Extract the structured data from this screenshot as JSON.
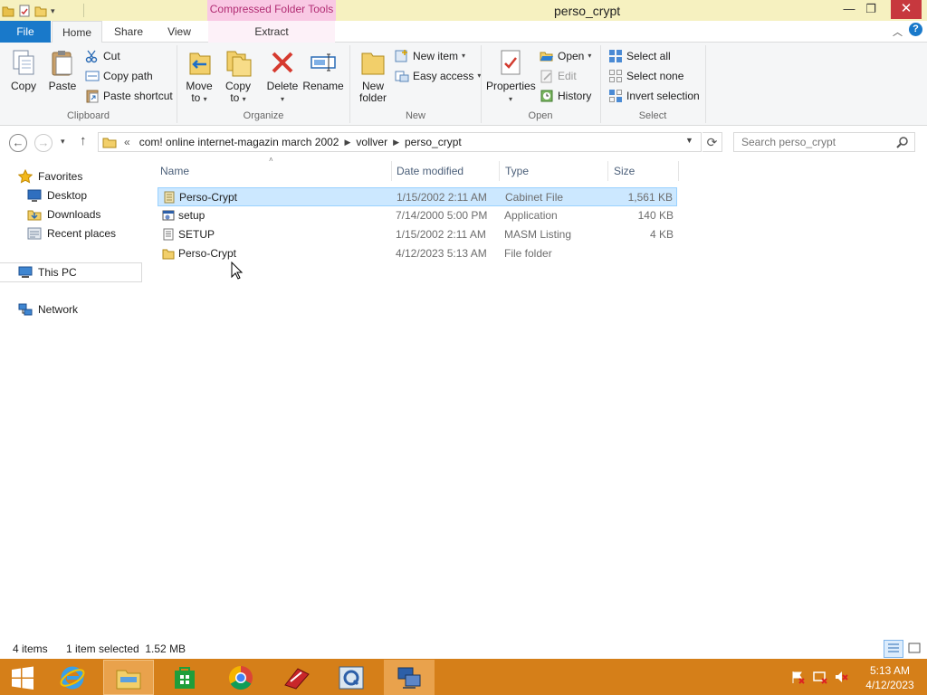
{
  "window": {
    "title": "perso_crypt",
    "context_tools_label": "Compressed Folder Tools"
  },
  "controls": {
    "minimize": "—",
    "maximize": "❐",
    "close": "✕",
    "help": "?"
  },
  "tabs": {
    "file": "File",
    "home": "Home",
    "share": "Share",
    "view": "View",
    "extract": "Extract"
  },
  "ribbon": {
    "clipboard": {
      "group_label": "Clipboard",
      "copy": "Copy",
      "paste": "Paste",
      "cut": "Cut",
      "copy_path": "Copy path",
      "paste_shortcut": "Paste shortcut"
    },
    "organize": {
      "group_label": "Organize",
      "move_to_1": "Move",
      "move_to_2": "to",
      "copy_to_1": "Copy",
      "copy_to_2": "to",
      "delete": "Delete",
      "rename": "Rename"
    },
    "new": {
      "group_label": "New",
      "new_folder_1": "New",
      "new_folder_2": "folder",
      "new_item": "New item",
      "easy_access": "Easy access"
    },
    "open": {
      "group_label": "Open",
      "properties": "Properties",
      "open": "Open",
      "edit": "Edit",
      "history": "History"
    },
    "select": {
      "group_label": "Select",
      "select_all": "Select all",
      "select_none": "Select none",
      "invert_selection": "Invert selection"
    }
  },
  "address": {
    "overflow": "«",
    "segments": [
      "com! online internet-magazin march 2002",
      "vollver",
      "perso_crypt"
    ],
    "search_placeholder": "Search perso_crypt"
  },
  "nav_pane": {
    "favorites": "Favorites",
    "desktop": "Desktop",
    "downloads": "Downloads",
    "recent_places": "Recent places",
    "this_pc": "This PC",
    "network": "Network"
  },
  "columns": {
    "name": "Name",
    "date": "Date modified",
    "type": "Type",
    "size": "Size"
  },
  "files": [
    {
      "name": "Perso-Crypt",
      "date": "1/15/2002 2:11 AM",
      "type": "Cabinet File",
      "size": "1,561 KB"
    },
    {
      "name": "setup",
      "date": "7/14/2000 5:00 PM",
      "type": "Application",
      "size": "140 KB"
    },
    {
      "name": "SETUP",
      "date": "1/15/2002 2:11 AM",
      "type": "MASM Listing",
      "size": "4 KB"
    },
    {
      "name": "Perso-Crypt",
      "date": "4/12/2023 5:13 AM",
      "type": "File folder",
      "size": ""
    }
  ],
  "status": {
    "count": "4 items",
    "selection": "1 item selected  1.52 MB"
  },
  "clock": {
    "time": "5:13 AM",
    "date": "4/12/2023"
  },
  "colors": {
    "accent": "#1979ca",
    "taskbar": "#d57f19",
    "selection": "#cce8ff",
    "context_tab": "#f9c9e4",
    "title_bar": "#f6f1c0"
  }
}
